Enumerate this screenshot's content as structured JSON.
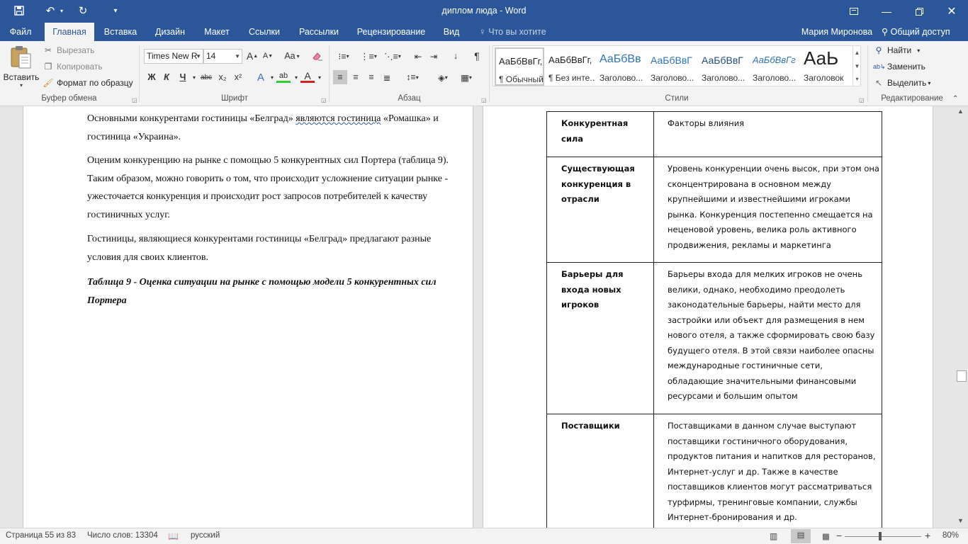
{
  "titlebar": {
    "title": "диплом люда - Word",
    "save_icon": "save-icon",
    "undo_icon": "undo-icon",
    "redo_icon": "repeat-icon",
    "customize_icon": "customize-qat-icon"
  },
  "tabs": [
    {
      "label": "Файл",
      "active": false
    },
    {
      "label": "Главная",
      "active": true
    },
    {
      "label": "Вставка",
      "active": false
    },
    {
      "label": "Дизайн",
      "active": false
    },
    {
      "label": "Макет",
      "active": false
    },
    {
      "label": "Ссылки",
      "active": false
    },
    {
      "label": "Рассылки",
      "active": false
    },
    {
      "label": "Рецензирование",
      "active": false
    },
    {
      "label": "Вид",
      "active": false
    }
  ],
  "tell_me": "Что вы хотите сделать?",
  "user": "Мария Миронова",
  "share": "Общий доступ",
  "clipboard": {
    "paste": "Вставить",
    "cut": "Вырезать",
    "copy": "Копировать",
    "format_painter": "Формат по образцу",
    "group": "Буфер обмена"
  },
  "font": {
    "name": "Times New R",
    "size": "14",
    "group": "Шрифт",
    "change_case": "Aa",
    "bold": "Ж",
    "italic": "К",
    "underline": "Ч",
    "strike": "abc",
    "sub": "x₂",
    "sup": "x²",
    "effects": "A",
    "highlight": "ab",
    "color": "A",
    "grow": "A",
    "shrink": "A"
  },
  "paragraph": {
    "group": "Абзац"
  },
  "styles": {
    "group": "Стили",
    "items": [
      {
        "preview": "АаБбВвГг,",
        "name": "¶ Обычный",
        "selected": true
      },
      {
        "preview": "АаБбВвГг,",
        "name": "¶ Без инте...",
        "selected": false
      },
      {
        "preview": "АаБбВв",
        "name": "Заголово...",
        "selected": false
      },
      {
        "preview": "АаБбВвГ",
        "name": "Заголово...",
        "selected": false
      },
      {
        "preview": "АаБбВвГ",
        "name": "Заголово...",
        "selected": false
      },
      {
        "preview": "АаБбВвГг",
        "name": "Заголово...",
        "selected": false
      },
      {
        "preview": "АаЬ",
        "name": "Заголовок",
        "selected": false
      }
    ]
  },
  "editing": {
    "group": "Редактирование",
    "find": "Найти",
    "replace": "Заменить",
    "select": "Выделить"
  },
  "page1": {
    "p1a": "Основными конкурентами гостиницы «Белград» ",
    "p1b": "являются  гостиница",
    "p1c": " «Ромашка» и гостиница «Украина».",
    "p2": "Оценим конкуренцию на рынке с помощью 5 конкурентных сил Портера (таблица 9). Таким образом, можно говорить о том, что происходит усложнение ситуации рынке - ужесточается конкуренция и происходит рост запросов потребителей к качеству гостиничных услуг.",
    "p3": "Гостиницы, являющиеся конкурентами гостиницы «Белград» предлагают разные условия для своих клиентов.",
    "caption": "Таблица 9 - Оценка ситуации на рынке с помощью модели 5 конкурентных сил Портера"
  },
  "table": {
    "rows": [
      {
        "force": "Конкурентная сила",
        "factors": "Факторы влияния"
      },
      {
        "force": "Существующая конкуренция в отрасли",
        "factors": "Уровень конкуренции очень высок, при этом она сконцентрирована в основном между крупнейшими и известнейшими игроками рынка. Конкуренция постепенно смещается на неценовой уровень, велика роль активного продвижения, рекламы и маркетинга"
      },
      {
        "force": "Барьеры для входа новых игроков",
        "factors": "Барьеры входа для мелких игроков не очень велики, однако, необходимо преодолеть законодательные барьеры, найти место для застройки или объект для размещения в нем нового отеля, а также сформировать свою базу будущего отеля. В этой связи наиболее опасны международные гостиничные сети, обладающие значительными финансовыми ресурсами и большим опытом"
      },
      {
        "force": "Поставщики",
        "factors": "Поставщиками в данном случае выступают поставщики гостиничного оборудования, продуктов питания и напитков для ресторанов, Интернет-услуг и др. Также в качестве поставщиков клиентов могут рассматриваться турфирмы, тренинговые компании, службы Интернет-бронирования и др."
      }
    ]
  },
  "status": {
    "page": "Страница 55 из 83",
    "words": "Число слов: 13304",
    "language": "русский",
    "zoom": "80%"
  }
}
